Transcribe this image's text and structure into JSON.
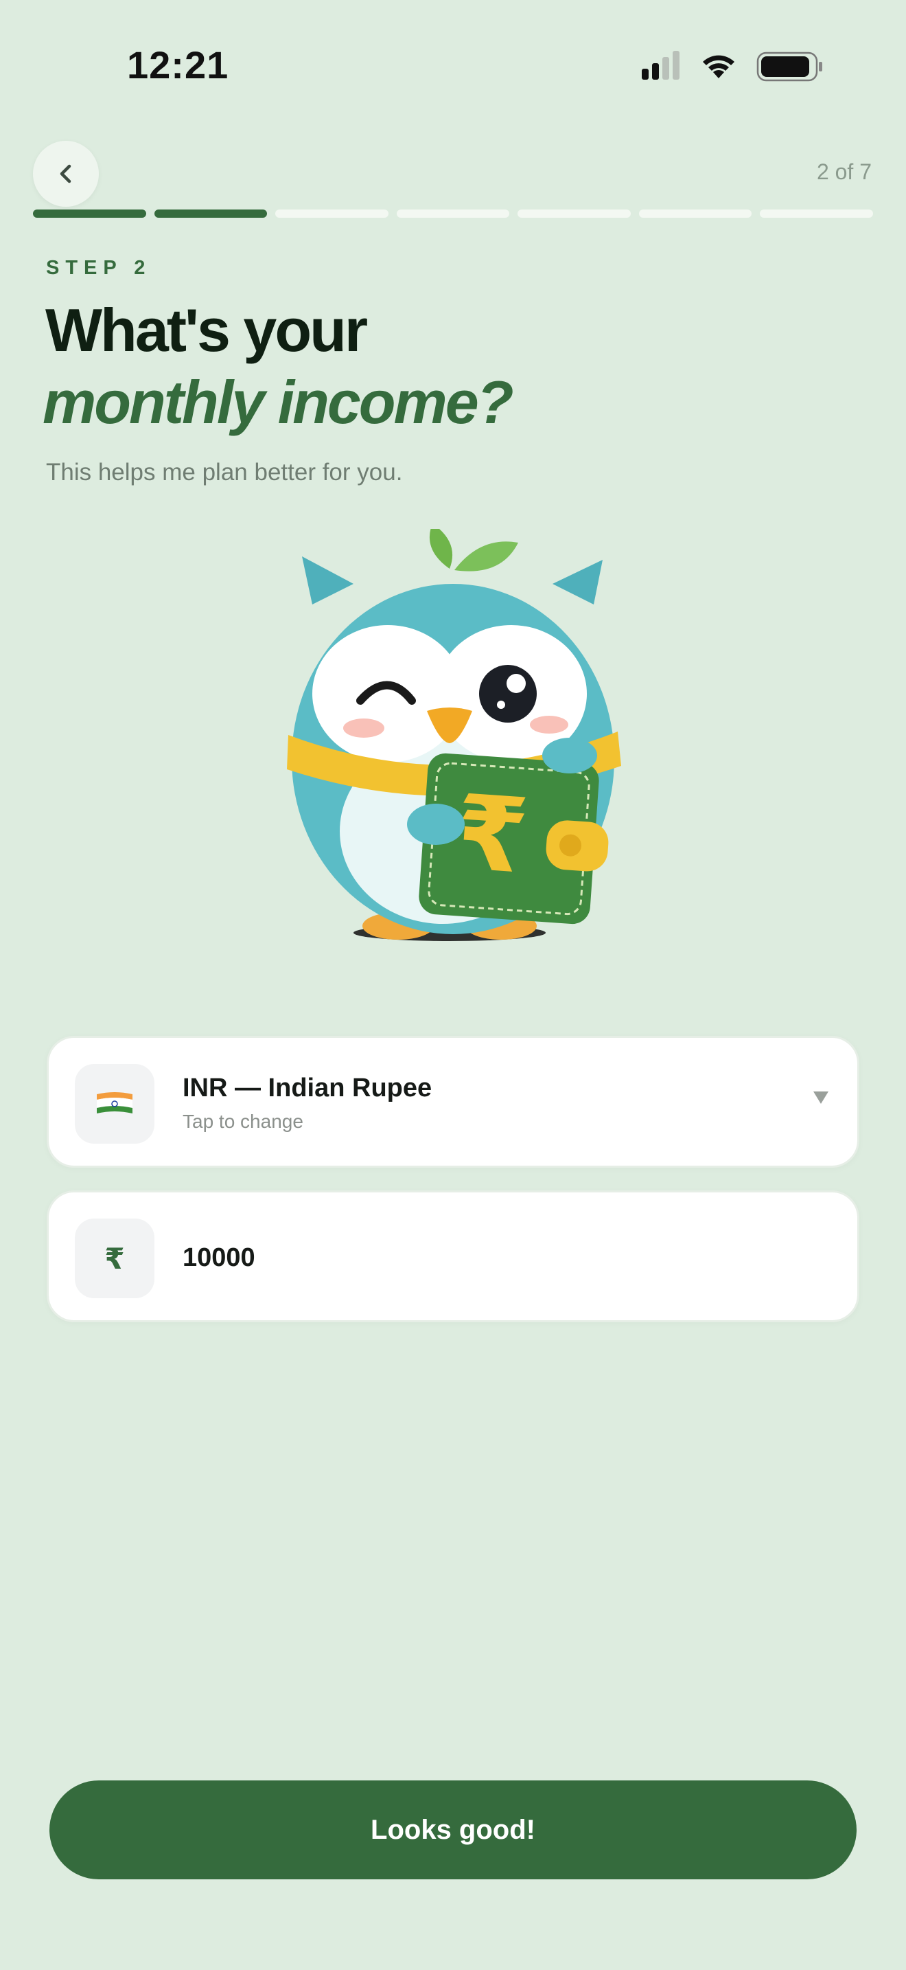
{
  "status_bar": {
    "time": "12:21"
  },
  "header": {
    "step_count": "2 of 7",
    "progress": {
      "current": 2,
      "total": 7
    }
  },
  "step_label": "STEP 2",
  "title": {
    "line1": "What's your",
    "line2": "monthly income?"
  },
  "subtitle": "This helps me plan better for you.",
  "currency": {
    "label": "INR — Indian Rupee",
    "hint": "Tap to change",
    "flag": "india-flag-icon"
  },
  "amount": {
    "value": "10000",
    "symbol": "₹"
  },
  "cta": {
    "label": "Looks good!"
  },
  "colors": {
    "background": "#ddecdf",
    "accent": "#356b3d",
    "owl": "#5bbcc6",
    "wallet": "#3f8a3f",
    "gold": "#f2c230"
  }
}
